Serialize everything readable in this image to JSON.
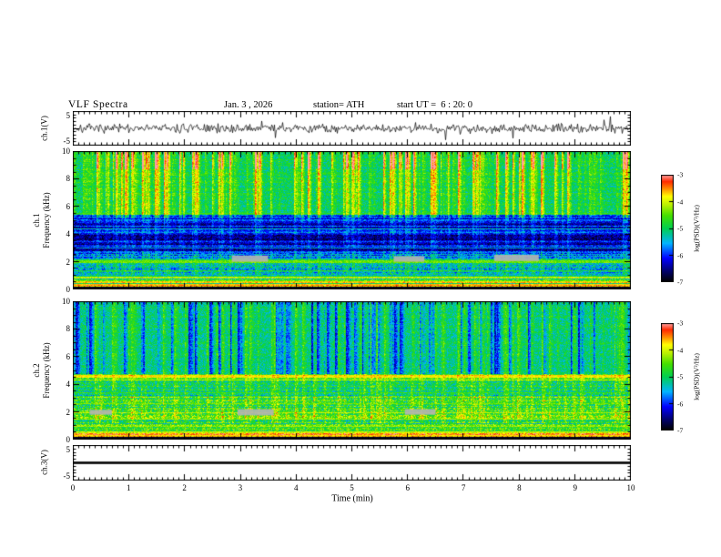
{
  "title": "VLF Spectra",
  "header": {
    "date": "Jan. 3 , 2026",
    "station": "station= ATH",
    "start_ut": "start UT =  6 : 20: 0"
  },
  "labels": {
    "wave1": "ch.1(V)",
    "spec1_line1": "ch.1",
    "spec1_line2": "Frequency (kHz)",
    "spec2_line1": "ch.2",
    "spec2_line2": "Frequency (kHz)",
    "wave3": "ch.3(V)",
    "xlabel": "Time (min)",
    "colorbar": "log(PSD)(V²/Hz)"
  },
  "ticks": {
    "x": [
      "0",
      "1",
      "2",
      "3",
      "4",
      "5",
      "6",
      "7",
      "8",
      "9",
      "10"
    ],
    "freq": [
      "10",
      "8",
      "6",
      "4",
      "2",
      "0"
    ],
    "wave": [
      "5",
      "-5"
    ],
    "colorbar": [
      "-3",
      "-4",
      "-5",
      "-6",
      "-7"
    ]
  },
  "chart_data": {
    "type": "heatmap",
    "title": "VLF Spectra, station ATH, Jan. 3 2026, start UT 6:20:0",
    "x_axis": {
      "label": "Time (min)",
      "range": [
        0,
        10
      ],
      "ticks": [
        0,
        1,
        2,
        3,
        4,
        5,
        6,
        7,
        8,
        9,
        10
      ]
    },
    "colormap": [
      [
        0,
        "#000000"
      ],
      [
        0.1,
        "#00006e"
      ],
      [
        0.22,
        "#0000ff"
      ],
      [
        0.36,
        "#00b4ff"
      ],
      [
        0.5,
        "#00d050"
      ],
      [
        0.62,
        "#44e000"
      ],
      [
        0.72,
        "#b8f000"
      ],
      [
        0.8,
        "#ffff00"
      ],
      [
        0.88,
        "#ff8000"
      ],
      [
        0.94,
        "#ff2a00"
      ],
      [
        1,
        "#ffa0a0"
      ]
    ],
    "colorbar": {
      "label": "log(PSD)(V²/Hz)",
      "range": [
        -7,
        -3
      ],
      "ticks": [
        -3,
        -4,
        -5,
        -6,
        -7
      ]
    },
    "waveform_ch1": {
      "type": "line",
      "ylabel": "ch.1(V)",
      "yrange": [
        -5,
        5
      ],
      "yticks": [
        5,
        -5
      ],
      "flat": false,
      "seed": 7,
      "noise": 0.8,
      "spike_prob": 0.015,
      "spike_min": 1.2,
      "spike_max": 3.4,
      "description": "broadband noise around 0 V with impulsive sferic spikes up to about ±4 V"
    },
    "spectrogram_ch1": {
      "type": "heatmap",
      "ylabel": "ch.1 Frequency (kHz)",
      "yrange": [
        0,
        10
      ],
      "yticks": [
        0,
        2,
        4,
        6,
        8,
        10
      ],
      "zrange": [
        -7,
        -3
      ],
      "seed": 11,
      "bands": [
        {
          "f": [
            0,
            0.22
          ],
          "v": 0.03,
          "n": 0.02,
          "stripe": 0
        },
        {
          "f": [
            0.22,
            0.6
          ],
          "v": 0.7,
          "n": 0.1,
          "stripe": 0.22
        },
        {
          "f": [
            0.6,
            1.15
          ],
          "v": 0.58,
          "n": 0.12,
          "stripe": 0.18
        },
        {
          "f": [
            1.15,
            1.85
          ],
          "v": 0.4,
          "n": 0.14,
          "stripe": 0.1
        },
        {
          "f": [
            1.85,
            2.2
          ],
          "v": 0.48,
          "n": 0.12,
          "stripe": 0.08
        },
        {
          "f": [
            2.2,
            2.65
          ],
          "v": 0.32,
          "n": 0.13,
          "stripe": 0.1
        },
        {
          "f": [
            2.65,
            5.4
          ],
          "v": 0.2,
          "n": 0.1,
          "stripe": 0.13
        },
        {
          "f": [
            5.4,
            10
          ],
          "v": 0.5,
          "n": 0.1,
          "stripe": 0.04
        }
      ],
      "lines": [
        {
          "f": 0.35,
          "v": 0.82,
          "w": 1
        },
        {
          "f": 0.55,
          "v": 0.78,
          "w": 0
        },
        {
          "f": 0.9,
          "v": 0.7,
          "w": 0
        },
        {
          "f": 1.35,
          "v": 0.55,
          "w": 0
        },
        {
          "f": 2.02,
          "v": 0.65,
          "w": 1
        },
        {
          "f": 3.0,
          "v": 0.36,
          "w": 0
        },
        {
          "f": 4.4,
          "v": 0.42,
          "w": 0
        },
        {
          "f": 5.55,
          "v": 0.58,
          "w": 0
        }
      ],
      "streaks": {
        "prob": 0.13,
        "zones": [
          {
            "track": "A",
            "f": [
              5.2,
              10
            ],
            "gain": 0.3
          },
          {
            "track": "A",
            "f": [
              1.1,
              5.2
            ],
            "gain": 0.1
          },
          {
            "track": "B",
            "f": [
              5.2,
              10
            ],
            "gain": 0.12
          }
        ],
        "top_red": {
          "f": 8.7,
          "gain": 0.28
        }
      },
      "gray_patches": [
        {
          "t": [
            2.85,
            3.5
          ],
          "f": [
            2.0,
            2.45
          ]
        },
        {
          "t": [
            5.75,
            6.3
          ],
          "f": [
            2.0,
            2.4
          ]
        },
        {
          "t": [
            7.55,
            8.35
          ],
          "f": [
            2.05,
            2.5
          ]
        }
      ],
      "description": "green background with vertical yellow/red burst striations above ~5 kHz, dark-blue band 2.6-5.4 kHz with horizontal striping, bright hum lines below 1.2 kHz and at ~2 kHz, black band below ~0.2 kHz, gray data-gap patches near 2.2 kHz"
    },
    "spectrogram_ch2": {
      "type": "heatmap",
      "ylabel": "ch.2 Frequency (kHz)",
      "yrange": [
        0,
        10
      ],
      "yticks": [
        0,
        2,
        4,
        6,
        8,
        10
      ],
      "zrange": [
        -7,
        -3
      ],
      "seed": 23,
      "bands": [
        {
          "f": [
            0,
            0.22
          ],
          "v": 0.03,
          "n": 0.02,
          "stripe": 0
        },
        {
          "f": [
            0.22,
            0.7
          ],
          "v": 0.68,
          "n": 0.12,
          "stripe": 0.22
        },
        {
          "f": [
            0.7,
            1.15
          ],
          "v": 0.55,
          "n": 0.15,
          "stripe": 0.12
        },
        {
          "f": [
            1.15,
            3.1
          ],
          "v": 0.56,
          "n": 0.16,
          "stripe": 0.1
        },
        {
          "f": [
            3.1,
            4.3
          ],
          "v": 0.48,
          "n": 0.14,
          "stripe": 0.08
        },
        {
          "f": [
            4.3,
            4.8
          ],
          "v": 0.62,
          "n": 0.12,
          "stripe": 0.12
        },
        {
          "f": [
            4.8,
            10
          ],
          "v": 0.47,
          "n": 0.1,
          "stripe": 0.03
        }
      ],
      "lines": [
        {
          "f": 0.35,
          "v": 0.82,
          "w": 1
        },
        {
          "f": 0.6,
          "v": 0.75,
          "w": 0
        },
        {
          "f": 1.0,
          "v": 0.68,
          "w": 0
        },
        {
          "f": 1.5,
          "v": 0.7,
          "w": 0
        },
        {
          "f": 2.0,
          "v": 0.72,
          "w": 0
        },
        {
          "f": 2.6,
          "v": 0.66,
          "w": 0
        },
        {
          "f": 3.4,
          "v": 0.6,
          "w": 0
        },
        {
          "f": 4.35,
          "v": 0.72,
          "w": 0
        },
        {
          "f": 4.6,
          "v": 0.8,
          "w": 1
        }
      ],
      "streaks": {
        "prob": 0.11,
        "zones": [
          {
            "track": "A",
            "f": [
              4.8,
              10
            ],
            "gain": -0.26
          },
          {
            "track": "B",
            "f": [
              1.2,
              10
            ],
            "gain": 0.14
          }
        ],
        "top_red": null
      },
      "gray_patches": [
        {
          "t": [
            0.3,
            0.7
          ],
          "f": [
            1.8,
            2.15
          ]
        },
        {
          "t": [
            2.95,
            3.6
          ],
          "f": [
            1.75,
            2.2
          ]
        },
        {
          "t": [
            5.95,
            6.5
          ],
          "f": [
            1.8,
            2.2
          ]
        }
      ],
      "description": "green background with dark-blue vertical streaks above ~5 kHz, busy green/yellow region 1-5 kHz with bright horizontal lines near 4.6 and 2 kHz, black band below ~0.2 kHz, gray data-gap patches near 2 kHz"
    },
    "waveform_ch3": {
      "type": "line",
      "ylabel": "ch.3(V)",
      "yrange": [
        -5,
        5
      ],
      "yticks": [
        5,
        -5
      ],
      "flat": true,
      "value": 0,
      "thickness": 2.6,
      "description": "constant 0 V flat thick line (channel inactive)"
    }
  }
}
